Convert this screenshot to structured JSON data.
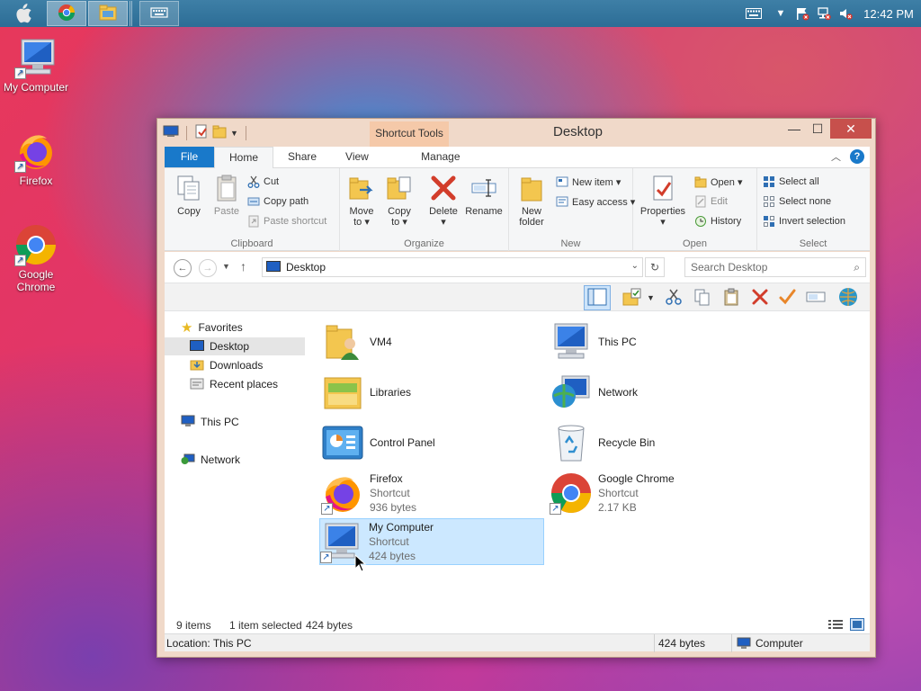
{
  "taskbar": {
    "apple_icon": "apple-logo-icon",
    "apps": [
      "chrome-icon",
      "file-explorer-icon",
      "keyboard-icon"
    ],
    "tray": {
      "keyboard": "keyboard-layout-icon",
      "chevron": "tray-chevron-icon",
      "icons": [
        "flag-warning-icon",
        "network-warning-icon",
        "speaker-muted-icon"
      ],
      "time": "12:42 PM"
    }
  },
  "desktop_icons": [
    {
      "label": "My Computer",
      "icon": "computer-icon"
    },
    {
      "label": "Firefox",
      "icon": "firefox-icon"
    },
    {
      "label": "Google Chrome",
      "icon": "chrome-icon"
    }
  ],
  "window": {
    "title": "Desktop",
    "context_tab": "Shortcut Tools",
    "tabs": {
      "file": "File",
      "home": "Home",
      "share": "Share",
      "view": "View",
      "manage": "Manage"
    },
    "ribbon": {
      "clipboard": {
        "label": "Clipboard",
        "copy": "Copy",
        "paste": "Paste",
        "cut": "Cut",
        "copy_path": "Copy path",
        "paste_shortcut": "Paste shortcut"
      },
      "organize": {
        "label": "Organize",
        "move_to_1": "Move",
        "move_to_2": "to ▾",
        "copy_to_1": "Copy",
        "copy_to_2": "to ▾",
        "delete_1": "Delete",
        "delete_2": "▾",
        "rename": "Rename"
      },
      "new": {
        "label": "New",
        "new_folder_1": "New",
        "new_folder_2": "folder",
        "new_item": "New item ▾",
        "easy_access": "Easy access ▾"
      },
      "open": {
        "label": "Open",
        "properties_1": "Properties",
        "properties_2": "▾",
        "open": "Open ▾",
        "edit": "Edit",
        "history": "History"
      },
      "select": {
        "label": "Select",
        "select_all": "Select all",
        "select_none": "Select none",
        "invert": "Invert selection"
      }
    },
    "address": {
      "path": "Desktop",
      "search_placeholder": "Search Desktop"
    },
    "nav": {
      "favorites": "Favorites",
      "desktop": "Desktop",
      "downloads": "Downloads",
      "recent": "Recent places",
      "this_pc": "This PC",
      "network": "Network"
    },
    "files": [
      {
        "name": "VM4",
        "sub1": "",
        "sub2": "",
        "icon": "user-folder-icon"
      },
      {
        "name": "This PC",
        "sub1": "",
        "sub2": "",
        "icon": "computer-icon"
      },
      {
        "name": "Libraries",
        "sub1": "",
        "sub2": "",
        "icon": "libraries-icon"
      },
      {
        "name": "Network",
        "sub1": "",
        "sub2": "",
        "icon": "network-globe-icon"
      },
      {
        "name": "Control Panel",
        "sub1": "",
        "sub2": "",
        "icon": "control-panel-icon"
      },
      {
        "name": "Recycle Bin",
        "sub1": "",
        "sub2": "",
        "icon": "recycle-bin-icon"
      },
      {
        "name": "Firefox",
        "sub1": "Shortcut",
        "sub2": "936 bytes",
        "icon": "firefox-icon"
      },
      {
        "name": "Google Chrome",
        "sub1": "Shortcut",
        "sub2": "2.17 KB",
        "icon": "chrome-icon"
      },
      {
        "name": "My Computer",
        "sub1": "Shortcut",
        "sub2": "424 bytes",
        "icon": "computer-icon",
        "selected": true
      }
    ],
    "status": {
      "count": "9 items",
      "selected": "1 item selected",
      "size": "424 bytes"
    },
    "bottom": {
      "location": "Location: This PC",
      "size": "424 bytes",
      "zone": "Computer"
    }
  }
}
